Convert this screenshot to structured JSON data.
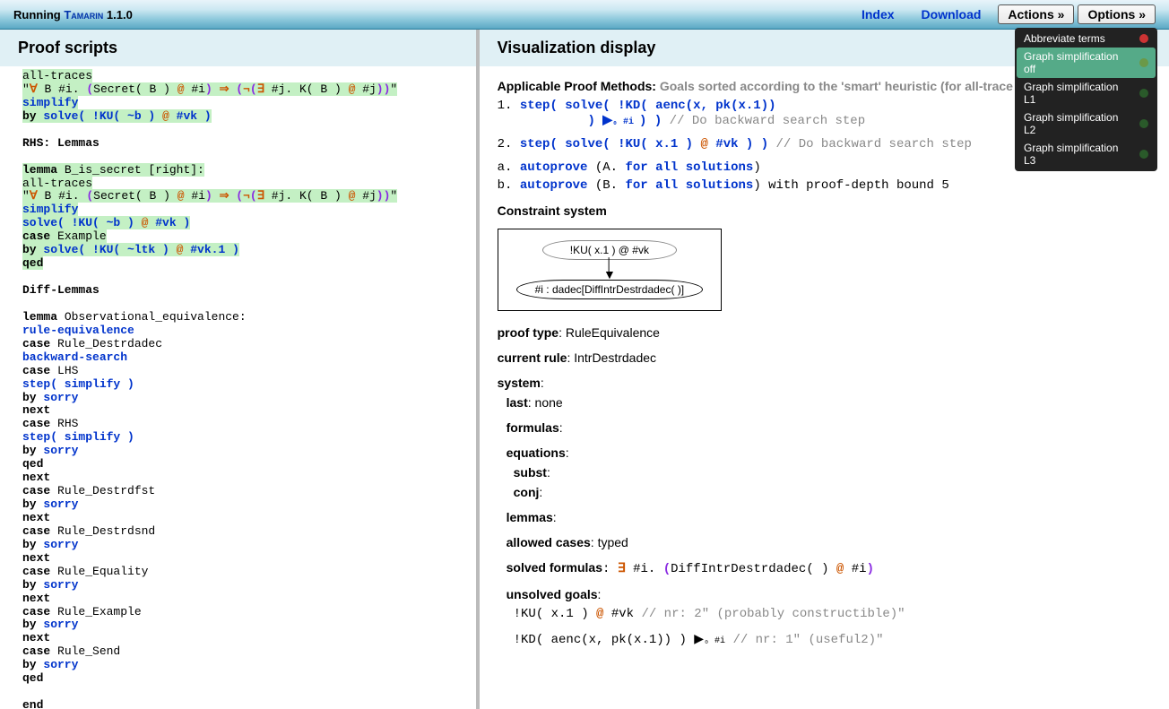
{
  "topbar": {
    "running": "Running",
    "app": "Tamarin",
    "version": " 1.1.0",
    "index": "Index",
    "download": "Download",
    "actions": "Actions »",
    "options": "Options »"
  },
  "options_menu": {
    "items": [
      {
        "label": "Abbreviate terms",
        "color": "#cc3333",
        "sel": false
      },
      {
        "label": "Graph simplification off",
        "color": "#6b9948",
        "sel": true
      },
      {
        "label": "Graph simplification L1",
        "color": "#2a5a2a",
        "sel": false
      },
      {
        "label": "Graph simplification L2",
        "color": "#2a5a2a",
        "sel": false
      },
      {
        "label": "Graph simplification L3",
        "color": "#2a5a2a",
        "sel": false
      }
    ]
  },
  "left": {
    "header": "Proof scripts",
    "lines": {
      "l1": "  all-traces",
      "l2a": "  \"",
      "l2b": "∀",
      "l2c": " B #i. ",
      "l2d": "(",
      "l2e": "Secret( B )",
      "l2f": " @ ",
      "l2g": "#i",
      "l2h": ")",
      "l2i": " ⇒ ",
      "l2j": "(",
      "l2k": "¬",
      "l2l": "(",
      "l2m": "∃",
      "l2n": " #j. K( B )",
      "l2o": " @ ",
      "l2p": "#j",
      "l2q": "))",
      "l2r": "\"",
      "l3": "simplify",
      "l4a": "by ",
      "l4b": "solve( ",
      "l4c": "!KU( ~b )",
      "l4d": " @ ",
      "l4e": "#vk",
      "l4f": " )",
      "l6": "RHS: Lemmas",
      "l8a": "lemma",
      "l8b": " B_is_secret [right]:",
      "l9": "  all-traces",
      "l10a": "  \"",
      "l10b": "∀",
      "l10c": " B #i. ",
      "l10d": "(",
      "l10e": "Secret( B )",
      "l10f": " @ ",
      "l10g": "#i",
      "l10h": ")",
      "l10i": " ⇒ ",
      "l10j": "(",
      "l10k": "¬",
      "l10l": "(",
      "l10m": "∃",
      "l10n": " #j. K( B )",
      "l10o": " @ ",
      "l10p": "#j",
      "l10q": "))",
      "l10r": "\"",
      "l11": "simplify",
      "l12a": "solve( ",
      "l12b": "!KU( ~b )",
      "l12c": " @ ",
      "l12d": "#vk",
      "l12e": " )",
      "l13a": "  case",
      "l13b": " Example",
      "l14a": "  by ",
      "l14b": "solve( ",
      "l14c": "!KU( ~ltk )",
      "l14d": " @ ",
      "l14e": "#vk.1",
      "l14f": " )",
      "l15": "qed",
      "l17": "Diff-Lemmas",
      "l19a": "lemma",
      "l19b": " Observational_equivalence:",
      "l20": "rule-equivalence",
      "l21a": "  case",
      "l21b": " Rule_Destrdadec",
      "l22": "  backward-search",
      "l23a": "    case",
      "l23b": " LHS",
      "l24": "    step( simplify )",
      "l25a": "      by ",
      "l25b": "sorry",
      "l26a": "  next",
      "l27a": "    case",
      "l27b": " RHS",
      "l28": "    step( simplify )",
      "l29a": "      by ",
      "l29b": "sorry",
      "l30": "  qed",
      "l31": "next",
      "l32a": "  case",
      "l32b": " Rule_Destrdfst",
      "l33a": "    by ",
      "l33b": "sorry",
      "l34": "next",
      "l35a": "  case",
      "l35b": " Rule_Destrdsnd",
      "l36a": "    by ",
      "l36b": "sorry",
      "l37": "next",
      "l38a": "  case",
      "l38b": " Rule_Equality",
      "l39a": "    by ",
      "l39b": "sorry",
      "l40": "next",
      "l41a": "  case",
      "l41b": " Rule_Example",
      "l42a": "    by ",
      "l42b": "sorry",
      "l43": "next",
      "l44a": "  case",
      "l44b": " Rule_Send",
      "l45a": "    by ",
      "l45b": "sorry",
      "l46": "qed",
      "l48": "end"
    }
  },
  "right": {
    "header": "Visualization display",
    "apm_label": "Applicable Proof Methods: ",
    "apm_desc": "Goals sorted according to the 'smart' heuristic (for all-trace proofs)",
    "m1_pre": "1. ",
    "m1a": "step( solve( ",
    "m1b": "!KD( aenc(x, pk(x.1))",
    "m1c": "            )",
    "m1d": " ▶",
    "m1e": "₀ #i ",
    "m1f": ") )",
    "m1g": " // Do backward search step",
    "m2_pre": "2. ",
    "m2a": "step( solve( ",
    "m2b": "!KU( x.1 )",
    "m2c": " @ ",
    "m2d": "#vk",
    "m2e": " ) )",
    "m2g": " // Do backward search step",
    "ma_pre": "a. ",
    "ma1": "autoprove",
    "ma2": " (A. ",
    "ma3": "for all solutions",
    "ma4": ")",
    "mb_pre": "b. ",
    "mb1": "autoprove",
    "mb2": " (B. ",
    "mb3": "for all solutions",
    "mb4": ") with proof-depth bound 5",
    "cs_header": "Constraint system",
    "graph_top": "!KU( x.1 ) @ #vk",
    "graph_bot": "#i : dadec[DiffIntrDestrdadec( )]",
    "pt_label": "proof type",
    "pt_val": ": RuleEquivalence",
    "cr_label": "current rule",
    "cr_val": ": IntrDestrdadec",
    "sys_label": "system",
    "sys_colon": ":",
    "last_label": "last",
    "last_val": ": none",
    "form_label": "formulas",
    "form_colon": ":",
    "eq_label": "equations",
    "eq_colon": ":",
    "subst_label": "subst",
    "subst_colon": ":",
    "conj_label": "conj",
    "conj_colon": ":",
    "lem_label": "lemmas",
    "lem_colon": ":",
    "ac_label": "allowed cases",
    "ac_val": ": typed",
    "sf_label": "solved formulas",
    "sf_1": ": ",
    "sf_ex": "∃",
    "sf_2": " #i. ",
    "sf_3": "(",
    "sf_4": "DiffIntrDestrdadec( )",
    "sf_at": " @ ",
    "sf_5": "#i",
    "sf_6": ")",
    "ug_label": "unsolved goals",
    "ug_colon": ":",
    "ug1a": "  !KU( x.1 )",
    "ug1b": " @ ",
    "ug1c": "#vk",
    "ug1d": " // nr: 2\" (probably constructible)\"",
    "ug2a": "  !KD( aenc(x, pk(x.1)) )",
    "ug2b": " ▶",
    "ug2c": "₀ #i",
    "ug2d": " // nr: 1\" (useful2)\""
  }
}
